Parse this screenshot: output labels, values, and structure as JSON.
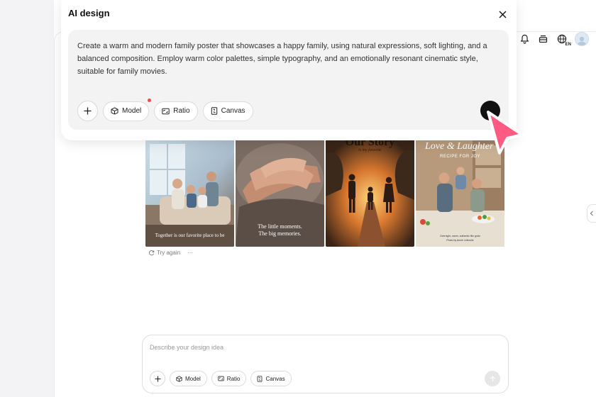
{
  "modal": {
    "title": "AI design",
    "prompt": "Create a warm and modern family poster that showcases a happy family, using natural expressions, soft lighting, and a balanced composition. Employ warm color palettes, simple typography, and an emotionally resonant cinematic style, suitable for family movies.",
    "chips": {
      "model": "Model",
      "ratio": "Ratio",
      "canvas": "Canvas"
    }
  },
  "topbar": {
    "language": "EN"
  },
  "gallery": {
    "tiles": [
      {
        "caption": "Together is our favorite place to be"
      },
      {
        "caption_line1": "The little moments.",
        "caption_line2": "The big memories."
      },
      {
        "title": "Our Story",
        "subtitle": "is my favorite"
      },
      {
        "title": "Love & Laughter",
        "subtitle": "RECIPE FOR JOY",
        "footer_line1": "Overnight, warm, authentic film grain",
        "footer_line2": "Photo by Annie Leibovitz"
      }
    ],
    "try_again": "Try again",
    "more": "···"
  },
  "bottom": {
    "placeholder": "Describe your design idea",
    "chips": {
      "model": "Model",
      "ratio": "Ratio",
      "canvas": "Canvas"
    }
  },
  "colors": {
    "accent_cursor": "#ff5a82",
    "notification_dot": "#f04a4a"
  }
}
